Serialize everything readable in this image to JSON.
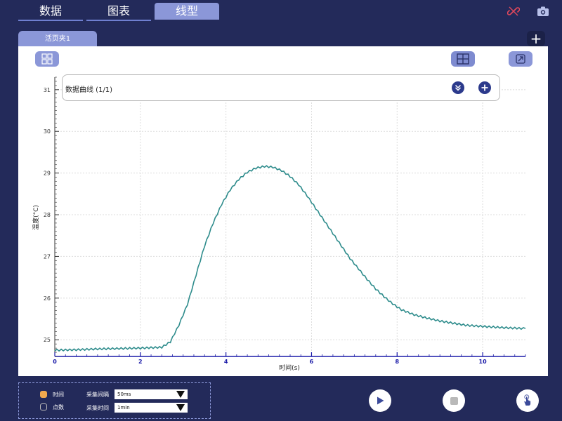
{
  "top_tabs": [
    {
      "label": "数据",
      "active": false
    },
    {
      "label": "图表",
      "active": false
    },
    {
      "label": "线型",
      "active": true
    }
  ],
  "icons": {
    "link": "unlink-icon",
    "camera": "camera-icon",
    "layout": "grid-layout-icon",
    "grid": "grid-icon",
    "export": "export-icon",
    "collapse": "double-chevron-down-icon",
    "add": "plus-icon",
    "play": "play-icon",
    "stop": "stop-icon",
    "touch": "hand-pointer-icon"
  },
  "page_tab": {
    "label": "活页夹1",
    "add_label": "+"
  },
  "legend": {
    "title": "数据曲线 (1/1)"
  },
  "colors": {
    "accent": "#8b97d8",
    "navy": "#232a5a",
    "series": "#2e8c8c",
    "axis": "#1a1aa8"
  },
  "bottom_panel": {
    "options": [
      {
        "label": "时间",
        "checked": true
      },
      {
        "label": "点数",
        "checked": false
      }
    ],
    "interval_label": "采集间隔",
    "interval_value": "50ms",
    "duration_label": "采集时间",
    "duration_value": "1min"
  },
  "chart_data": {
    "type": "line",
    "title": "",
    "xlabel": "时间(s)",
    "ylabel": "温度(°C)",
    "xlim": [
      0,
      11
    ],
    "ylim": [
      24.6,
      31.3
    ],
    "x_ticks": [
      0,
      2,
      4,
      6,
      8,
      10
    ],
    "y_ticks": [
      25,
      26,
      27,
      28,
      29,
      30,
      31
    ],
    "grid": true,
    "series": [
      {
        "x": [
          0,
          0.5,
          1.0,
          1.5,
          2.0,
          2.5,
          2.7,
          2.9,
          3.1,
          3.3,
          3.5,
          3.7,
          3.9,
          4.1,
          4.3,
          4.5,
          4.7,
          4.9,
          5.1,
          5.3,
          5.5,
          5.7,
          5.9,
          6.1,
          6.3,
          6.5,
          6.7,
          6.9,
          7.1,
          7.3,
          7.5,
          7.7,
          7.9,
          8.1,
          8.4,
          8.7,
          9.0,
          9.3,
          9.6,
          10.0,
          10.5,
          11.0
        ],
        "y": [
          24.75,
          24.76,
          24.78,
          24.79,
          24.8,
          24.82,
          24.95,
          25.35,
          25.85,
          26.55,
          27.25,
          27.8,
          28.25,
          28.6,
          28.85,
          29.02,
          29.12,
          29.16,
          29.14,
          29.06,
          28.92,
          28.72,
          28.45,
          28.15,
          27.85,
          27.55,
          27.25,
          26.95,
          26.7,
          26.45,
          26.22,
          26.03,
          25.86,
          25.72,
          25.6,
          25.52,
          25.45,
          25.4,
          25.35,
          25.32,
          25.29,
          25.27
        ]
      }
    ]
  }
}
